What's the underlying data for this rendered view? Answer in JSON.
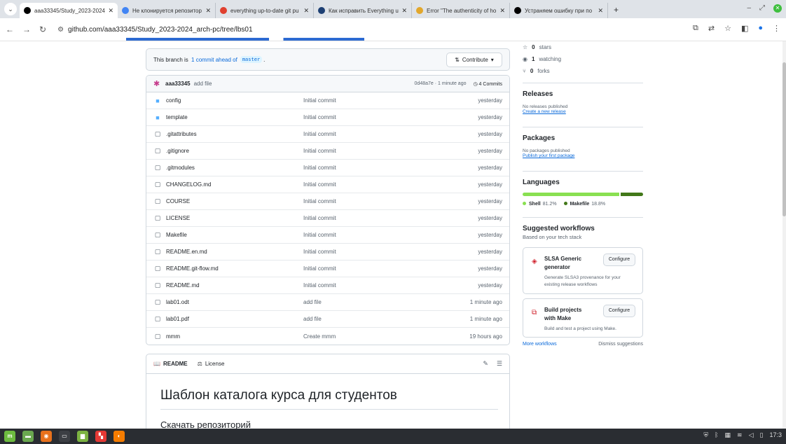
{
  "browser": {
    "tabs": [
      {
        "title": "aaa33345/Study_2023-2024_",
        "active": true,
        "favicon": "github-icon",
        "color": "#000000"
      },
      {
        "title": "Не клонируется репозитор",
        "active": false,
        "favicon": "google-icon",
        "color": "#4285f4"
      },
      {
        "title": "everything up-to-date git pu",
        "active": false,
        "favicon": "brave-icon",
        "color": "#e0402f"
      },
      {
        "title": "Как исправить Everything u",
        "active": false,
        "favicon": "page-icon",
        "color": "#1d3f73"
      },
      {
        "title": "Error \"The authenticity of ho",
        "active": false,
        "favicon": "lightning-icon",
        "color": "#e2a72c"
      },
      {
        "title": "Устраняем ошибку при по",
        "active": false,
        "favicon": "github-icon",
        "color": "#000000"
      }
    ],
    "url": "github.com/aaa33345/Study_2023-2024_arch-pc/tree/lbs01"
  },
  "banner": {
    "prefix": "This branch is",
    "ahead_link": "1 commit ahead of",
    "branch": "master",
    "suffix": ".",
    "contribute_label": "Contribute"
  },
  "commit": {
    "user": "aaa33345",
    "message": "add file",
    "meta": "0d48a7e · 1 minute ago",
    "commits_label": "4 Commits"
  },
  "files": [
    {
      "name": "config",
      "type": "folder",
      "message": "Initial commit",
      "time": "yesterday"
    },
    {
      "name": "template",
      "type": "folder",
      "message": "Initial commit",
      "time": "yesterday"
    },
    {
      "name": ".gitattributes",
      "type": "file",
      "message": "Initial commit",
      "time": "yesterday"
    },
    {
      "name": ".gitignore",
      "type": "file",
      "message": "Initial commit",
      "time": "yesterday"
    },
    {
      "name": ".gitmodules",
      "type": "file",
      "message": "Initial commit",
      "time": "yesterday"
    },
    {
      "name": "CHANGELOG.md",
      "type": "file",
      "message": "Initial commit",
      "time": "yesterday"
    },
    {
      "name": "COURSE",
      "type": "file",
      "message": "Initial commit",
      "time": "yesterday"
    },
    {
      "name": "LICENSE",
      "type": "file",
      "message": "Initial commit",
      "time": "yesterday"
    },
    {
      "name": "Makefile",
      "type": "file",
      "message": "Initial commit",
      "time": "yesterday"
    },
    {
      "name": "README.en.md",
      "type": "file",
      "message": "Initial commit",
      "time": "yesterday"
    },
    {
      "name": "README.git-flow.md",
      "type": "file",
      "message": "Initial commit",
      "time": "yesterday"
    },
    {
      "name": "README.md",
      "type": "file",
      "message": "Initial commit",
      "time": "yesterday"
    },
    {
      "name": "lab01.odt",
      "type": "file",
      "message": "add file",
      "time": "1 minute ago"
    },
    {
      "name": "lab01.pdf",
      "type": "file",
      "message": "add file",
      "time": "1 minute ago"
    },
    {
      "name": "mmm",
      "type": "file",
      "message": "Create mmm",
      "time": "19 hours ago"
    }
  ],
  "readme": {
    "tab_readme": "README",
    "tab_license": "License",
    "heading": "Шаблон каталога курса для студентов",
    "subheading": "Скачать репозиторий"
  },
  "sidebar": {
    "stars": {
      "count": "0",
      "label": "stars"
    },
    "watching": {
      "count": "1",
      "label": "watching"
    },
    "forks": {
      "count": "0",
      "label": "forks"
    },
    "releases": {
      "title": "Releases",
      "none": "No releases published",
      "link": "Create a new release"
    },
    "packages": {
      "title": "Packages",
      "none": "No packages published",
      "link": "Publish your first package"
    },
    "languages": {
      "title": "Languages",
      "items": [
        {
          "name": "Shell",
          "percent": "81.2%",
          "value": 81.2,
          "color": "#89e051"
        },
        {
          "name": "Makefile",
          "percent": "18.8%",
          "value": 18.8,
          "color": "#427819"
        }
      ]
    },
    "workflows": {
      "title": "Suggested workflows",
      "subtitle": "Based on your tech stack",
      "cards": [
        {
          "title": "SLSA Generic generator",
          "desc": "Generate SLSA3 provenance for your existing release workflows",
          "button": "Configure"
        },
        {
          "title": "Build projects with Make",
          "desc": "Build and test a project using Make.",
          "button": "Configure"
        }
      ],
      "more": "More workflows",
      "dismiss": "Dismiss suggestions"
    }
  },
  "taskbar": {
    "clock": "17:3"
  }
}
